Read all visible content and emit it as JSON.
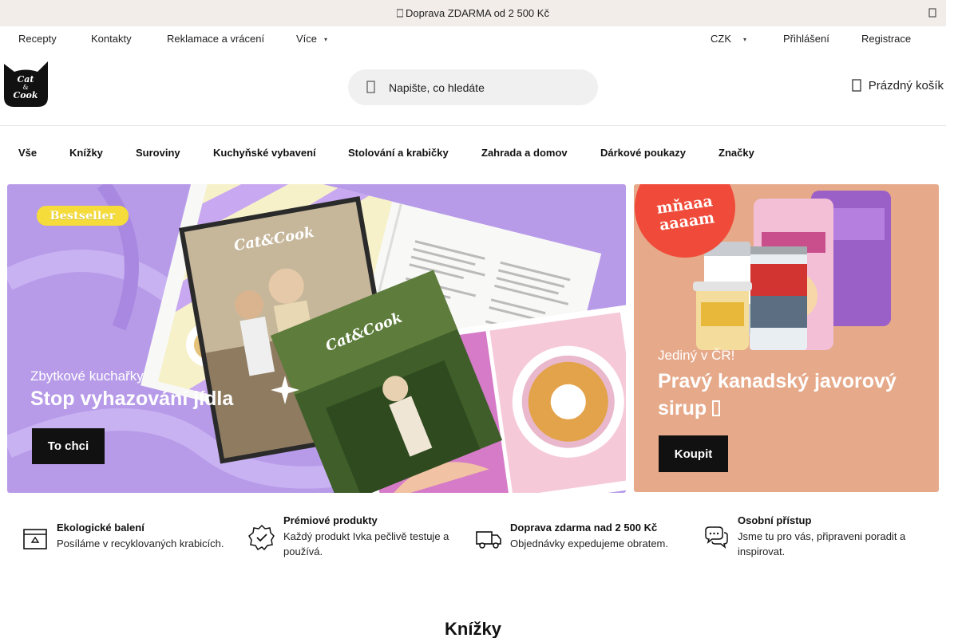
{
  "announcement": {
    "text": "Doprava ZDARMA od 2 500 Kč"
  },
  "topnav": {
    "links": [
      "Recepty",
      "Kontakty",
      "Reklamace a vrácení",
      "Více"
    ],
    "currency": "CZK",
    "login": "Přihlášení",
    "register": "Registrace"
  },
  "header": {
    "logo_text": "Cat & Cook",
    "search_placeholder": "Napište, co hledáte",
    "cart_label": "Prázdný košík"
  },
  "categories": [
    "Vše",
    "Knížky",
    "Suroviny",
    "Kuchyňské vybavení",
    "Stolování a krabičky",
    "Zahrada a domov",
    "Dárkové poukazy",
    "Značky"
  ],
  "banner_left": {
    "badge": "Bestseller",
    "subtitle": "Zbytkové kuchařky",
    "title": "Stop vyhazování jídla",
    "button": "To chci",
    "book_brand": "Cat&Cook"
  },
  "banner_right": {
    "stamp": "mňaaa aaaam",
    "subtitle": "Jediný v ČR!",
    "title": "Pravý kanadský javorový sirup",
    "button": "Koupit"
  },
  "features": [
    {
      "title": "Ekologické balení",
      "desc": "Posíláme v recyklovaných krabicích.",
      "icon": "eco-box-icon"
    },
    {
      "title": "Prémiové produkty",
      "desc": "Každý produkt Ivka pečlivě testuje a používá.",
      "icon": "badge-check-icon"
    },
    {
      "title": "Doprava zdarma nad 2 500 Kč",
      "desc": "Objednávky expedujeme obratem.",
      "icon": "truck-icon"
    },
    {
      "title": "Osobní přístup",
      "desc": "Jsme tu pro vás, připraveni poradit a inspirovat.",
      "icon": "chat-icon"
    }
  ],
  "section_title": "Knížky",
  "colors": {
    "announce_bg": "#f2ede9",
    "banner_left_bg": "#b79be9",
    "banner_right_bg": "#e6a98a",
    "badge_yellow": "#f5dc3b",
    "stamp_red": "#f04b3a",
    "button_dark": "#111111"
  }
}
